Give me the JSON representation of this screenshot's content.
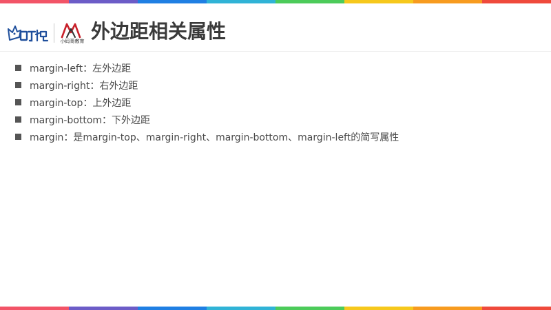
{
  "colors": {
    "stripe": [
      "#f25467",
      "#6c5cc7",
      "#1f7fe3",
      "#30b3d6",
      "#4ccb5a",
      "#f6c81c",
      "#f79b1f",
      "#ef4a3c"
    ],
    "title": "#3a3a3a",
    "body_text": "#4a4a4a",
    "bullet": "#555555",
    "logo_blue": "#1f4f9c",
    "logo_red": "#c8202a"
  },
  "header": {
    "logo_left": {
      "icon": "qiding-logo-icon",
      "text": "叩丁狼"
    },
    "logo_right": {
      "icon": "xiaomage-logo-icon",
      "caption": "小码哥教育"
    },
    "title": "外边距相关属性"
  },
  "content": {
    "items": [
      {
        "text": "margin-left：左外边距"
      },
      {
        "text": "margin-right：右外边距"
      },
      {
        "text": "margin-top：上外边距"
      },
      {
        "text": "margin-bottom：下外边距"
      },
      {
        "text": "margin：是margin-top、margin-right、margin-bottom、margin-left的简写属性"
      }
    ]
  }
}
